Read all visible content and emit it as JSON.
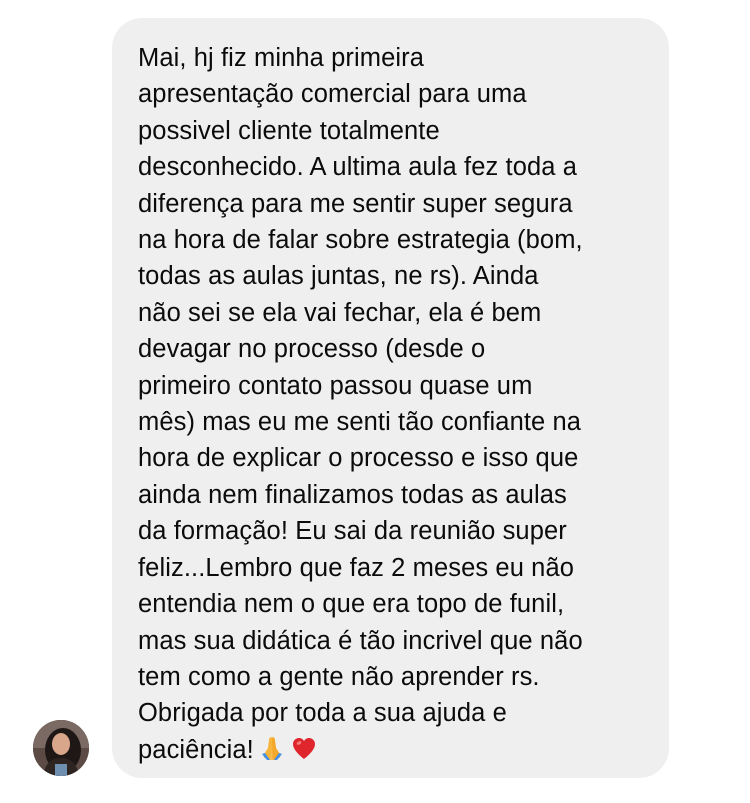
{
  "conversation": {
    "message": {
      "text": "Mai, hj fiz minha primeira\napresentação comercial para uma\npossivel cliente totalmente\ndesconhecido. A ultima aula fez toda a\ndiferença para me sentir super segura\nna hora de falar sobre estrategia (bom,\ntodas as aulas juntas, ne rs). Ainda\nnão sei se ela vai fechar, ela é bem\ndevagar no processo (desde o\nprimeiro contato passou quase um\nmês) mas eu me senti tão confiante na\nhora de explicar o processo e isso que\nainda nem finalizamos todas as aulas\nda formação! Eu sai da reunião super\nfeliz...Lembro que faz 2 meses eu não\nentendia nem o que era topo de funil,\nmas sua didática é tão incrivel que não\ntem como a gente não aprender rs.\nObrigada por toda a sua ajuda e\npaciência!",
      "emojis": [
        "folded-hands",
        "red-heart"
      ]
    },
    "colors": {
      "bubble_bg": "#efeff0",
      "text": "#0b0b0b",
      "heart": "#e0262d",
      "hands": "#f6b43a"
    }
  }
}
